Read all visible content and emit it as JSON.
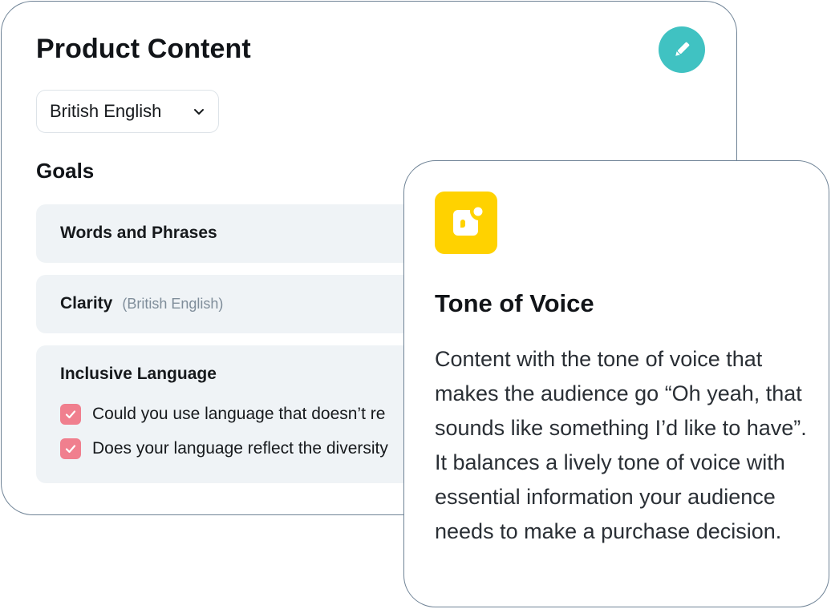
{
  "product_card": {
    "title": "Product Content",
    "edit_icon": "pencil-icon",
    "language_select": {
      "value": "British English",
      "icon": "chevron-down-icon"
    },
    "goals_heading": "Goals",
    "goals": [
      {
        "title": "Words and Phrases"
      },
      {
        "title": "Clarity",
        "subtitle": "(British English)"
      },
      {
        "title": "Inclusive Language",
        "checks": [
          {
            "text": "Could you use language that doesn’t re",
            "checked": true
          },
          {
            "text": "Does your language reflect the diversity",
            "checked": true
          }
        ]
      }
    ]
  },
  "tone_card": {
    "icon": "speech-bubble-icon",
    "title": "Tone of Voice",
    "description": "Content with the tone of voice that makes the audience go “Oh yeah, that sounds like something I’d like to have”. It balances a lively tone of voice with essential information your audience needs to make a purchase decision."
  },
  "colors": {
    "edit_button": "#40c2c2",
    "checkbox": "#f07f8e",
    "tone_icon_bg": "#ffd200",
    "goal_panel_bg": "#eff3f6",
    "card_border": "#6f8396"
  }
}
